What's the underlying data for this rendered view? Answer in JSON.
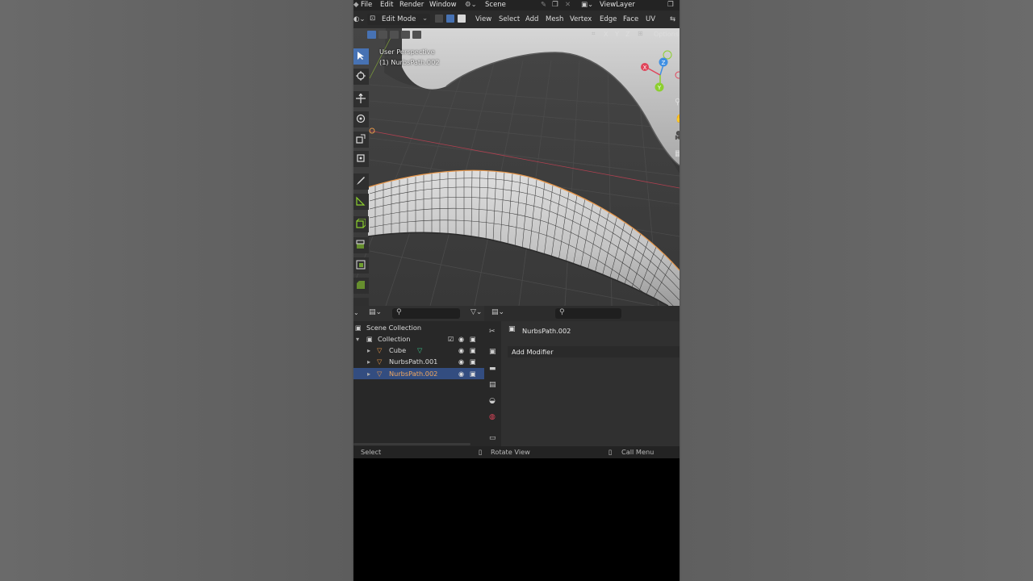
{
  "menu": {
    "items": [
      "File",
      "Edit",
      "Render",
      "Window"
    ],
    "scene": "Scene",
    "view_layer": "ViewLayer"
  },
  "header": {
    "mode": "Edit Mode",
    "menu_items": [
      "View",
      "Select",
      "Add",
      "Mesh",
      "Vertex",
      "Edge",
      "Face",
      "UV"
    ]
  },
  "viewport": {
    "title": "User Perspective",
    "subtitle": "(1) NurbsPath.002",
    "axes": [
      "X",
      "Y",
      "Z"
    ],
    "options_label": "Options",
    "gizmo": {
      "x": "X",
      "y": "Y",
      "z": "Z"
    }
  },
  "outliner": {
    "root": "Scene Collection",
    "collection": "Collection",
    "items": [
      {
        "name": "Cube",
        "selected": false
      },
      {
        "name": "NurbsPath.001",
        "selected": false
      },
      {
        "name": "NurbsPath.002",
        "selected": true
      }
    ]
  },
  "properties": {
    "object_name": "NurbsPath.002",
    "add_modifier_label": "Add Modifier"
  },
  "status": {
    "select": "Select",
    "rotate": "Rotate View",
    "call_menu": "Call Menu"
  },
  "colors": {
    "accent": "#4772b3",
    "selected_row": "#334d80",
    "object_orange": "#e8974a",
    "x_axis": "#e0455a",
    "y_axis": "#8ccf2f",
    "z_axis": "#3e8fe3"
  }
}
